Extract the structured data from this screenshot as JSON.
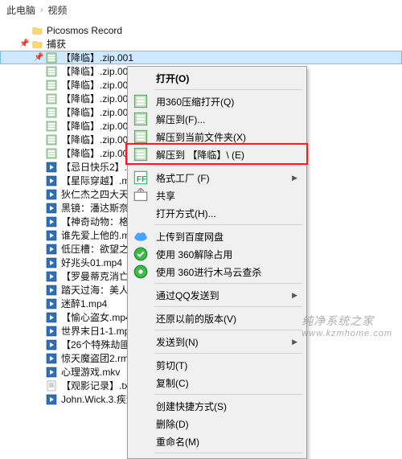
{
  "breadcrumb": {
    "root": "此电脑",
    "folder": "视频"
  },
  "folders": [
    {
      "name": "Picosmos Record",
      "pinned": false
    },
    {
      "name": "捕获",
      "pinned": true
    }
  ],
  "selected_file": "【降临】.zip.001",
  "files": [
    "【降临】.zip.002",
    "【降临】.zip.003",
    "【降临】.zip.004",
    "【降临】.zip.005",
    "【降临】.zip.006",
    "【降临】.zip.007",
    "【降临】.zip.008",
    "【忌日快乐2】.mkv",
    "【星际穿越】.mkv",
    "狄仁杰之四大天王.mk",
    "黑镜：潘达斯奈基.mk",
    "【神奇动物：格林德沃之",
    "谁先爱上他的.mkv",
    "低压槽：欲望之城.mk",
    "好兆头01.mp4",
    "【罗曼蒂克消亡史.mp4",
    "踏天过海：美人计.m",
    "迷醉1.mp4",
    "【愉心盗女.mp4",
    "世界末日1-1.mp4",
    "【26个特殊劫匪】.rm",
    "惊天魔盗团2.rmvb",
    "心理游戏.mkv",
    "【观影记录】.txt",
    "John.Wick.3.疾速备战"
  ],
  "menu_header": "打开(O)",
  "menu_items_1": [
    {
      "label": "用360压缩打开(Q)",
      "icon": "zip"
    },
    {
      "label": "解压到(F)...",
      "icon": "zip"
    },
    {
      "label": "解压到当前文件夹(X)",
      "icon": "zip"
    },
    {
      "label": "解压到 【降临】\\ (E)",
      "icon": "zip",
      "highlight": true
    }
  ],
  "menu_items_2": [
    {
      "label": "格式工厂 (F)",
      "icon": "ff",
      "sub": true
    },
    {
      "label": "共享",
      "icon": "share"
    },
    {
      "label": "打开方式(H)...",
      "icon": ""
    }
  ],
  "menu_items_3": [
    {
      "label": "上传到百度网盘",
      "icon": "cloud"
    },
    {
      "label": "使用 360解除占用",
      "icon": "sh1"
    },
    {
      "label": "使用 360进行木马云查杀",
      "icon": "sh2"
    }
  ],
  "menu_items_4": [
    {
      "label": "通过QQ发送到",
      "icon": "",
      "sub": true
    }
  ],
  "menu_items_5": [
    {
      "label": "还原以前的版本(V)",
      "icon": ""
    }
  ],
  "menu_items_6": [
    {
      "label": "发送到(N)",
      "icon": "",
      "sub": true
    }
  ],
  "menu_items_7": [
    {
      "label": "剪切(T)",
      "icon": ""
    },
    {
      "label": "复制(C)",
      "icon": ""
    }
  ],
  "menu_items_8": [
    {
      "label": "创建快捷方式(S)",
      "icon": ""
    },
    {
      "label": "删除(D)",
      "icon": ""
    },
    {
      "label": "重命名(M)",
      "icon": ""
    }
  ],
  "watermark_a": "纯净系统之家",
  "watermark_b": "www.kzmhome.com"
}
